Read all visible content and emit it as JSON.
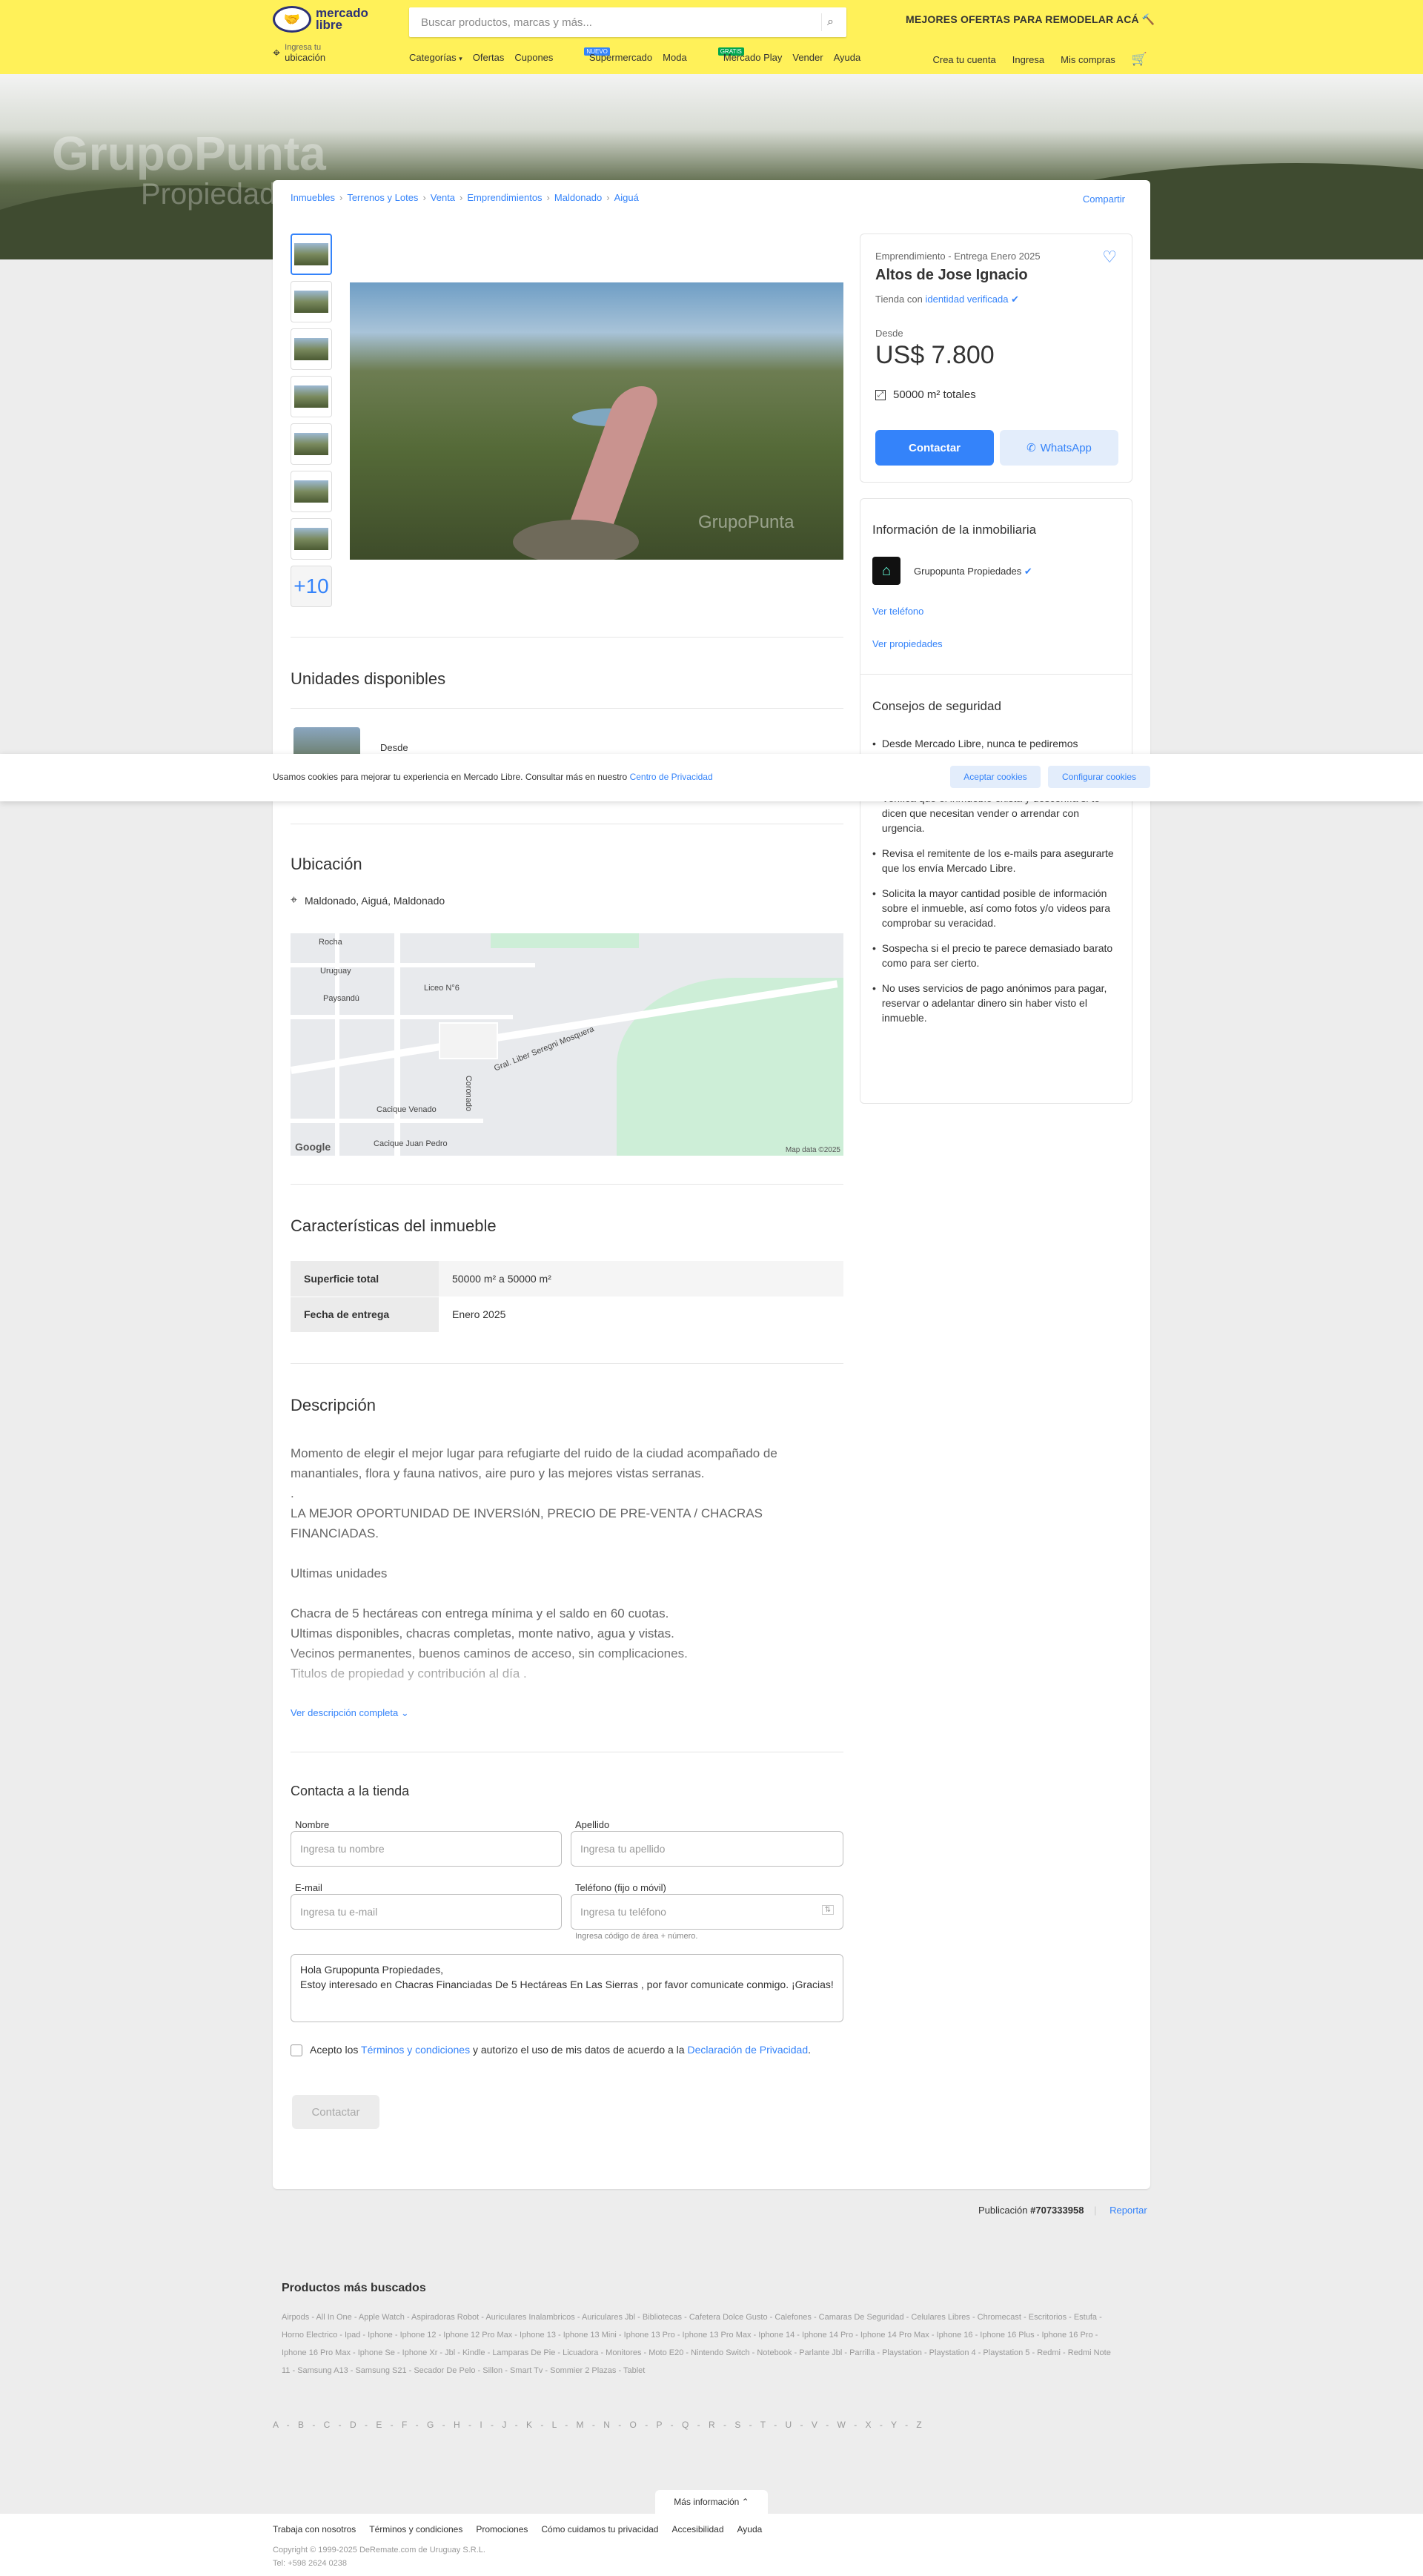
{
  "header": {
    "logo_text": "mercado libre",
    "search_placeholder": "Buscar productos, marcas y más...",
    "promo": "MEJORES OFERTAS PARA REMODELAR ACÁ",
    "location_line1": "Ingresa tu",
    "location_line2": "ubicación",
    "nav": [
      "Categorías",
      "Ofertas",
      "Cupones",
      "Supermercado",
      "Moda",
      "Mercado Play",
      "Vender",
      "Ayuda"
    ],
    "tag_nuevo": "NUEVO",
    "tag_gratis": "GRATIS",
    "account": [
      "Crea tu cuenta",
      "Ingresa",
      "Mis compras"
    ]
  },
  "hero": {
    "watermark": "GrupoPunta",
    "watermark_sub": "Propiedades"
  },
  "breadcrumb": [
    "Inmuebles",
    "Terrenos y Lotes",
    "Venta",
    "Emprendimientos",
    "Maldonado",
    "Aiguá"
  ],
  "share": "Compartir",
  "gallery": {
    "more_label": "+10",
    "image_watermark": "GrupoPunta"
  },
  "listing": {
    "subtitle": "Emprendimiento - Entrega Enero 2025",
    "title": "Altos de Jose Ignacio",
    "store_prefix": "Tienda con",
    "store_link": "identidad verificada",
    "desde": "Desde",
    "price": "US$ 7.800",
    "area": "50000 m² totales",
    "contact_btn": "Contactar",
    "whatsapp_btn": "WhatsApp"
  },
  "inmobiliaria": {
    "title": "Información de la inmobiliaria",
    "name": "Grupopunta Propiedades",
    "ver_telefono": "Ver teléfono",
    "ver_propiedades": "Ver propiedades"
  },
  "seguridad": {
    "title": "Consejos de seguridad",
    "tips": [
      "Desde Mercado Libre, nunca te pediremos contraseñas, PIN o códigos de verificación a través de WhatsApp, teléfono, SMS o email.",
      "Verifica que el inmueble exista y desconfía si te dicen que necesitan vender o arrendar con urgencia.",
      "Revisa el remitente de los e-mails para asegurarte que los envía Mercado Libre.",
      "Solicita la mayor cantidad posible de información sobre el inmueble, así como fotos y/o videos para comprobar su veracidad.",
      "Sospecha si el precio te parece demasiado barato como para ser cierto.",
      "No uses servicios de pago anónimos para pagar, reservar o adelantar dinero sin haber visto el inmueble."
    ]
  },
  "unidades": {
    "title": "Unidades disponibles",
    "desde": "Desde"
  },
  "cookie": {
    "text": "Usamos cookies para mejorar tu experiencia en Mercado Libre. Consultar más en nuestro",
    "link": "Centro de Privacidad",
    "accept": "Aceptar cookies",
    "config": "Configurar cookies"
  },
  "ubicacion": {
    "title": "Ubicación",
    "address": "Maldonado, Aiguá, Maldonado",
    "map_streets": [
      "Rocha",
      "Uruguay",
      "Paysandú",
      "Liceo N°6",
      "Gral. Liber Seregni Mosquera",
      "Cacique Venado",
      "Cacique Juan Pedro",
      "Coronado"
    ],
    "map_brand": "Google",
    "map_data": "Map data ©2025"
  },
  "caracteristicas": {
    "title": "Características del inmueble",
    "rows": [
      {
        "k": "Superficie total",
        "v": "50000 m² a 50000 m²"
      },
      {
        "k": "Fecha de entrega",
        "v": "Enero 2025"
      }
    ]
  },
  "descripcion": {
    "title": "Descripción",
    "text": "Momento de elegir el mejor lugar para refugiarte del ruido de la ciudad acompañado de manantiales, flora y fauna nativos, aire puro y las mejores vistas serranas.\n.\nLA MEJOR OPORTUNIDAD DE INVERSIóN, PRECIO DE PRE-VENTA / CHACRAS FINANCIADAS.\n\nUltimas unidades\n\nChacra de 5 hectáreas con entrega mínima y el saldo en 60 cuotas.\nUltimas disponibles, chacras completas, monte nativo, agua y vistas.\nVecinos permanentes, buenos caminos de acceso, sin complicaciones.\nTitulos de propiedad y contribución al día .",
    "ver_mas": "Ver descripción completa"
  },
  "form": {
    "title": "Contacta a la tienda",
    "nombre_label": "Nombre",
    "nombre_ph": "Ingresa tu nombre",
    "apellido_label": "Apellido",
    "apellido_ph": "Ingresa tu apellido",
    "email_label": "E-mail",
    "email_ph": "Ingresa tu e-mail",
    "tel_label": "Teléfono (fijo o móvil)",
    "tel_ph": "Ingresa tu teléfono",
    "tel_hint": "Ingresa código de área + número.",
    "message": "Hola Grupopunta Propiedades,\nEstoy interesado en Chacras Financiadas De 5 Hectáreas En Las Sierras  , por favor comunicate conmigo. ¡Gracias!",
    "terms_pre": "Acepto los",
    "terms_link": "Términos y condiciones",
    "terms_mid": "y autorizo el uso de mis datos de acuerdo a la",
    "terms_link2": "Declaración de Privacidad",
    "submit": "Contactar"
  },
  "publicacion": {
    "label": "Publicación",
    "id": "#707333958",
    "report": "Reportar"
  },
  "mas_buscados": {
    "title": "Productos más buscados",
    "items": "Airpods - All In One - Apple Watch - Aspiradoras Robot - Auriculares Inalambricos - Auriculares Jbl - Bibliotecas - Cafetera Dolce Gusto - Calefones - Camaras De Seguridad - Celulares Libres - Chromecast - Escritorios - Estufa - Horno Electrico - Ipad - Iphone - Iphone 12 - Iphone 12 Pro Max - Iphone 13 - Iphone 13 Mini - Iphone 13 Pro - Iphone 13 Pro Max - Iphone 14 - Iphone 14 Pro - Iphone 14 Pro Max - Iphone 16 - Iphone 16 Plus - Iphone 16 Pro - Iphone 16 Pro Max - Iphone Se - Iphone Xr - Jbl - Kindle - Lamparas De Pie - Licuadora - Monitores - Moto E20 - Nintendo Switch - Notebook - Parlante Jbl - Parrilla - Playstation - Playstation 4 - Playstation 5 - Redmi - Redmi Note 11 - Samsung A13 - Samsung S21 - Secador De Pelo - Sillon - Smart Tv - Sommier 2 Plazas - Tablet"
  },
  "alphabet": "A - B - C - D - E - F - G - H - I - J - K - L - M - N - O - P - Q - R - S - T - U - V - W - X - Y - Z",
  "footer": {
    "more_info": "Más información",
    "links": [
      "Trabaja con nosotros",
      "Términos y condiciones",
      "Promociones",
      "Cómo cuidamos tu privacidad",
      "Accesibilidad",
      "Ayuda"
    ],
    "copy": "Copyright © 1999-2025 DeRemate.com de Uruguay S.R.L.\nTel: +598 2624 0238"
  }
}
